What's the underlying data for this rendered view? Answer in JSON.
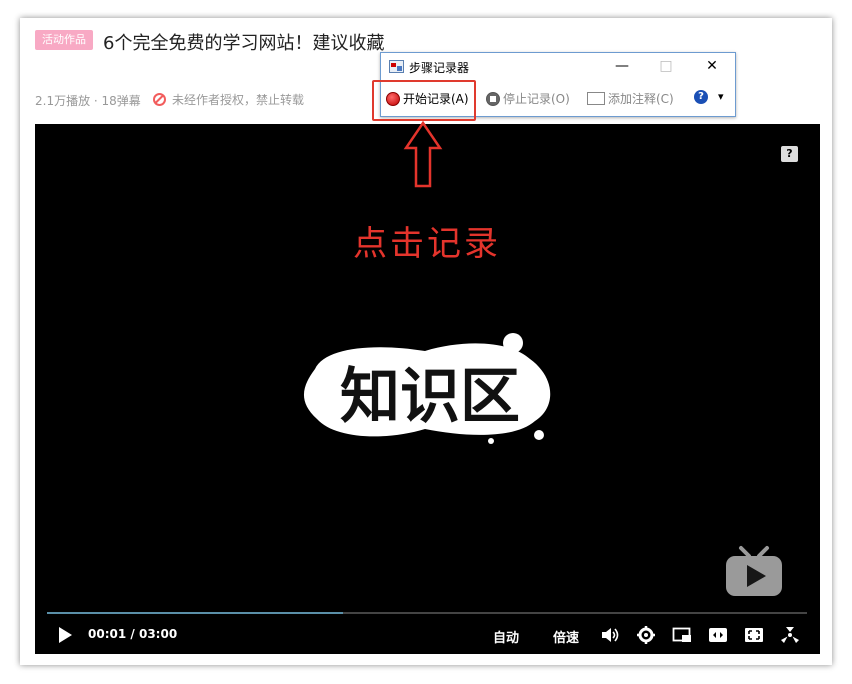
{
  "header": {
    "tag": "活动作品",
    "title": "6个完全免费的学习网站！建议收藏",
    "stats": "2.1万播放 · 18弹幕",
    "notice": "未经作者授权，禁止转载"
  },
  "steps_recorder": {
    "window_title": "步骤记录器",
    "minimize": "—",
    "maximize": "□",
    "close": "✕",
    "start_record": "开始记录(A)",
    "stop_record": "停止记录(O)",
    "add_comment": "添加注释(C)",
    "help": "?",
    "dropdown": "▾"
  },
  "annotation": {
    "callout": "点击记录"
  },
  "video": {
    "help_badge": "?",
    "logo_text": "知识区",
    "progress_fraction": 0.39,
    "current_time": "00:01",
    "time_separator": "/",
    "duration": "03:00",
    "auto_label": "自动",
    "speed_label": "倍速"
  },
  "colors": {
    "tag_bg": "#f8a9c4",
    "annotation_red": "#e4342c",
    "progress": "#5a8fa8",
    "video_bg": "#000000"
  }
}
